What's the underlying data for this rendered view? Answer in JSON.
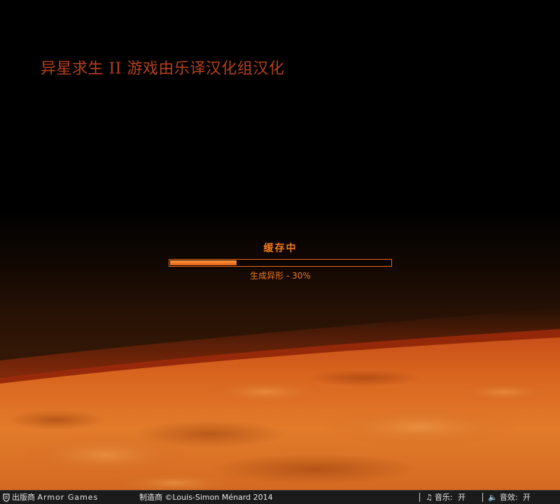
{
  "title": "异星求生 II 游戏由乐译汉化组汉化",
  "loader": {
    "heading": "缓存中",
    "status": "生成异形 - 30%",
    "progress": 0.3
  },
  "footer": {
    "publisher_label": "出版商",
    "publisher_name": "Armor Games",
    "developer_label": "制造商",
    "developer_name": "©Louis-Simon Ménard 2014",
    "music_label": "音乐:",
    "music_value": "开",
    "sound_label": "音效:",
    "sound_value": "开",
    "music_icon": "music-note-icon",
    "sound_icon": "speaker-icon"
  },
  "colors": {
    "accent": "#f07a1c",
    "title": "#b5401a",
    "footer_bg": "#1b1b1b"
  }
}
